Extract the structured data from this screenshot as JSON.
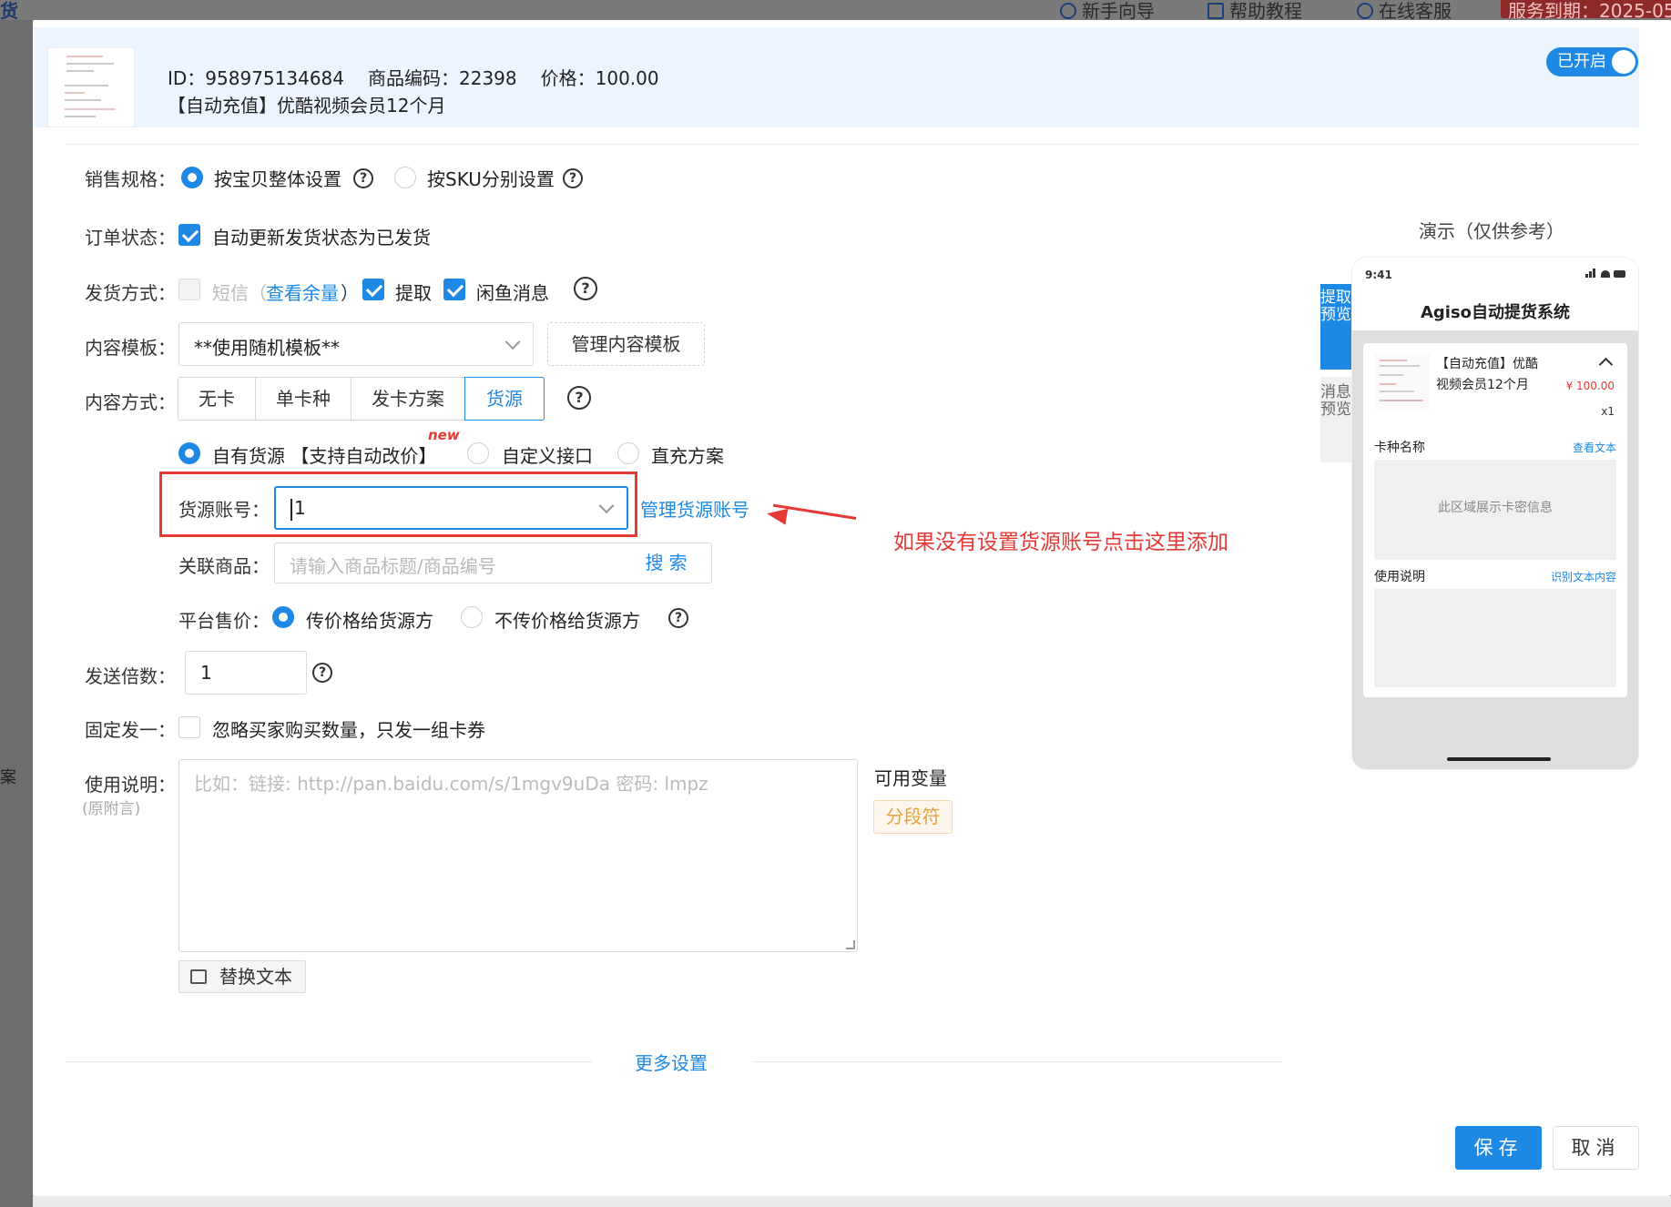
{
  "background": {
    "side_top_char": "货",
    "side_mid_char": "案",
    "links": [
      "新手向导",
      "帮助教程",
      "在线客服"
    ],
    "expire_text": "服务到期：2025-05"
  },
  "header": {
    "id_text": "ID：958975134684",
    "code_text": "商品编码：22398",
    "price_text": "价格：100.00",
    "title": "【自动充值】优酷视频会员12个月",
    "toggle_label": "已开启"
  },
  "form": {
    "sales_spec": {
      "label": "销售规格：",
      "options": [
        "按宝贝整体设置",
        "按SKU分别设置"
      ],
      "selected": "按宝贝整体设置"
    },
    "order_status": {
      "label": "订单状态：",
      "checkbox_label": "自动更新发货状态为已发货",
      "checked": true
    },
    "delivery": {
      "label": "发货方式：",
      "sms_label": "短信",
      "sms_open": "（",
      "sms_link": "查看余量",
      "sms_close": "）",
      "pickup_label": "提取",
      "xianyu_label": "闲鱼消息"
    },
    "template": {
      "label": "内容模板：",
      "value": "**使用随机模板**",
      "manage_button": "管理内容模板"
    },
    "content_mode": {
      "label": "内容方式：",
      "tabs": [
        "无卡",
        "单卡种",
        "发卡方案",
        "货源"
      ],
      "active": "货源"
    },
    "source": {
      "options": [
        "自有货源 【支持自动改价】",
        "自定义接口",
        "直充方案"
      ],
      "selected": "自有货源 【支持自动改价】",
      "new_tag": "new"
    },
    "source_account": {
      "label": "货源账号：",
      "value": "1",
      "manage_link": "管理货源账号"
    },
    "linked_goods": {
      "label": "关联商品：",
      "placeholder": "请输入商品标题/商品编号",
      "search_button": "搜索"
    },
    "platform_price": {
      "label": "平台售价：",
      "options": [
        "传价格给货源方",
        "不传价格给货源方"
      ],
      "selected": "传价格给货源方"
    },
    "multiplier": {
      "label": "发送倍数：",
      "value": "1"
    },
    "fixed_one": {
      "label": "固定发一：",
      "checkbox_label": "忽略买家购买数量，只发一组卡券",
      "checked": false
    },
    "instructions": {
      "label": "使用说明：",
      "sub_label": "(原附言)",
      "placeholder": "比如：链接: http://pan.baidu.com/s/1mgv9uDa 密码: lmpz",
      "variables_label": "可用变量",
      "variable_tag": "分段符",
      "replace_button": "替换文本"
    },
    "more_settings": "更多设置"
  },
  "annotation": {
    "text": "如果没有设置货源账号点击这里添加",
    "color": "#e53935"
  },
  "preview": {
    "title": "演示（仅供参考）",
    "tab_active": "提取预览",
    "tab_inactive": "消息预览",
    "phone_time": "9:41",
    "app_title": "Agiso自动提货系统",
    "product_name": "【自动充值】优酷视频会员12个月",
    "price": "¥ 100.00",
    "qty": "x1",
    "card_name_label": "卡种名称",
    "view_text_link": "查看文本",
    "card_area_text": "此区域展示卡密信息",
    "usage_label": "使用说明",
    "recognize_link": "识别文本内容"
  },
  "buttons": {
    "save": "保存",
    "cancel": "取消"
  },
  "colors": {
    "primary": "#1e88e5",
    "header_bg": "#ecf5ff",
    "warning": "#e6a23c"
  }
}
